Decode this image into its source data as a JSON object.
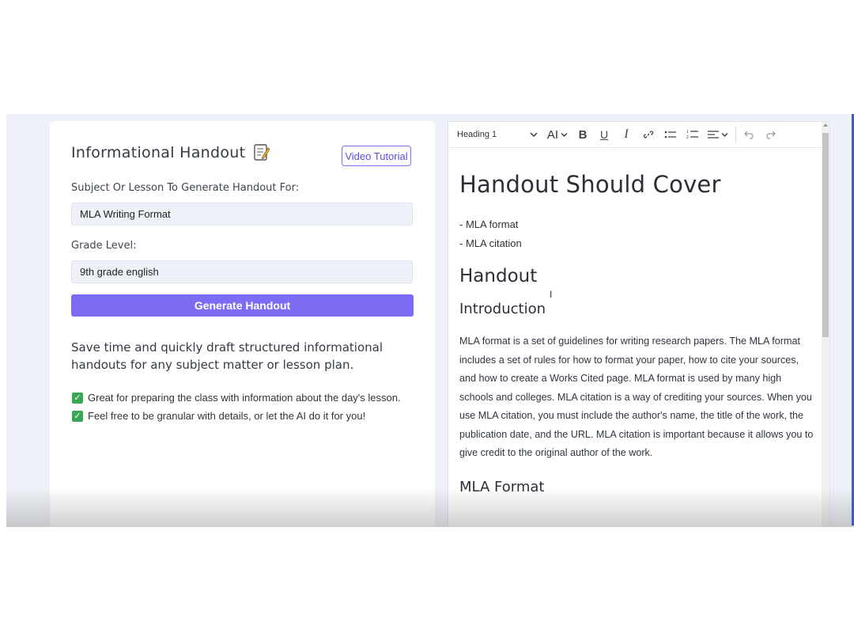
{
  "form": {
    "title": "Informational Handout",
    "title_icon": "memo-icon",
    "video_button": "Video Tutorial",
    "subject_label": "Subject Or Lesson To Generate Handout For:",
    "subject_value": "MLA Writing Format",
    "grade_label": "Grade Level:",
    "grade_value": "9th grade english",
    "generate_button": "Generate Handout",
    "description": "Save time and quickly draft structured informational handouts for any subject matter or lesson plan.",
    "bullets": [
      "Great for preparing the class with information about the day's lesson.",
      "Feel free to be granular with details, or let the AI do it for you!"
    ]
  },
  "toolbar": {
    "heading_select": "Heading 1",
    "icons": [
      "font-size-icon",
      "bold-icon",
      "underline-icon",
      "italic-icon",
      "link-icon",
      "bulleted-list-icon",
      "numbered-list-icon",
      "align-icon",
      "undo-icon",
      "redo-icon"
    ]
  },
  "editor": {
    "h1": "Handout Should Cover",
    "items": [
      "- MLA format",
      "- MLA citation"
    ],
    "h2": "Handout",
    "h3_intro": "Introduction",
    "intro_paragraph": "MLA format is a set of guidelines for writing research papers. The MLA format includes a set of rules for how to format your paper, how to cite your sources, and how to create a Works Cited page. MLA format is used by many high schools and colleges. MLA citation is a way of crediting your sources. When you use MLA citation, you must include the author's name, the title of the work, the publication date, and the URL. MLA citation is important because it allows you to give credit to the original author of the work.",
    "h3_format": "MLA Format"
  },
  "colors": {
    "accent": "#7c6cf3",
    "check": "#3aa757",
    "background": "#eef1f7"
  }
}
